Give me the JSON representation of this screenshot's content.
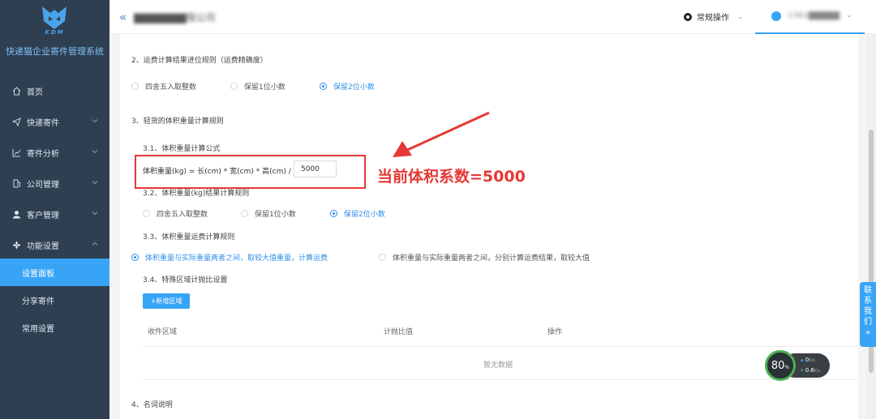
{
  "app": {
    "logo_text": "KDM",
    "title": "快递猫企业寄件管理系统"
  },
  "sidebar": {
    "items": [
      {
        "label": "首页",
        "icon": "home-icon"
      },
      {
        "label": "快递寄件",
        "icon": "send-icon"
      },
      {
        "label": "寄件分析",
        "icon": "chart-icon"
      },
      {
        "label": "公司管理",
        "icon": "building-icon"
      },
      {
        "label": "客户管理",
        "icon": "user-icon"
      },
      {
        "label": "功能设置",
        "icon": "settings-icon"
      }
    ],
    "sub_items": [
      {
        "label": "设置面板",
        "active": true
      },
      {
        "label": "分享寄件",
        "active": false
      },
      {
        "label": "常用设置",
        "active": false
      }
    ]
  },
  "header": {
    "collapse_glyph": "«",
    "company_name": "▇▇▇▇▇▇▇限公司",
    "ops_label": "常规操作",
    "user_name": "1381▇▇▇▇▇"
  },
  "settings": {
    "sec2_title": "2、运费计算结果进位规则（运费精确度）",
    "sec2_options": [
      "四舍五入取整数",
      "保留1位小数",
      "保留2位小数"
    ],
    "sec3_title": "3、轻货的体积重量计算规则",
    "sec31_title": "3.1、体积重量计算公式",
    "formula_label": "体积重量(kg) = 长(cm) * 宽(cm) * 高(cm) /",
    "coefficient": "5000",
    "sec32_title": "3.2、体积重量(kg)结果计算规则",
    "sec32_options": [
      "四舍五入取整数",
      "保留1位小数",
      "保留2位小数"
    ],
    "sec33_title": "3.3、体积重量运费计算规则",
    "sec33_options": [
      "体积重量与实际重量两者之间，取较大值重量，计算运费",
      "体积重量与实际重量两者之间，分别计算运费结果，取较大值"
    ],
    "sec34_title": "3.4、特殊区域计抛比设置",
    "add_region_label": "+新增区域",
    "table_headers": [
      "收件区域",
      "计抛比值",
      "操作"
    ],
    "empty_text": "暂无数据",
    "sec4_title": "4、名词说明"
  },
  "annotation": {
    "text": "当前体积系数=5000",
    "color": "#e53935"
  },
  "contact": {
    "chars": [
      "联",
      "系",
      "我",
      "们",
      "«"
    ]
  },
  "speed_widget": {
    "percent": "80",
    "percent_unit": "%",
    "up": "0",
    "down": "0.6",
    "unit": "K/s"
  },
  "colors": {
    "sidebar_bg": "#2e3f52",
    "accent": "#38a4f6",
    "highlight_red": "#e53935"
  }
}
